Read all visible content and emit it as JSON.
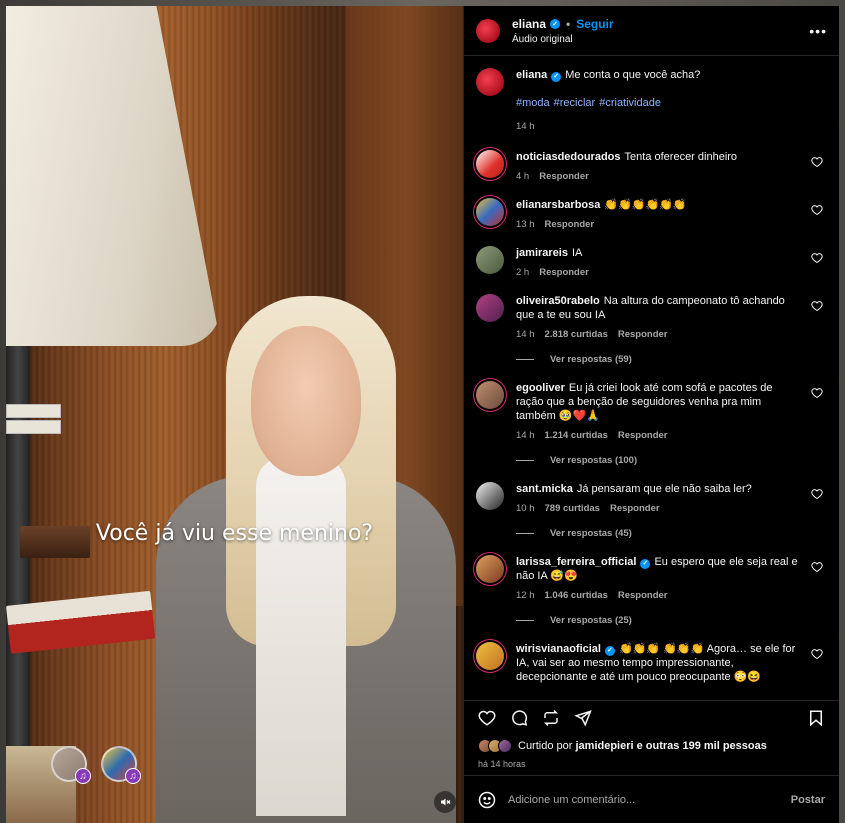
{
  "post": {
    "username": "eliana",
    "follow_label": "Seguir",
    "audio_label": "Áudio original",
    "more_icon": "more-horizontal-icon",
    "video_caption": "Você já viu esse menino?",
    "caption_text": "Me conta o que você acha?",
    "hashtags": [
      "#moda",
      "#reciclar",
      "#criatividade"
    ],
    "caption_time": "14 h"
  },
  "comments": [
    {
      "user": "noticiasdedourados",
      "verified": false,
      "text": "Tenta oferecer dinheiro",
      "time": "4 h",
      "likes": "",
      "reply_label": "Responder",
      "replies": ""
    },
    {
      "user": "elianarsbarbosa",
      "verified": false,
      "text": "👏👏👏👏👏👏",
      "time": "13 h",
      "likes": "",
      "reply_label": "Responder",
      "replies": ""
    },
    {
      "user": "jamirareis",
      "verified": false,
      "text": "IA",
      "time": "2 h",
      "likes": "",
      "reply_label": "Responder",
      "replies": ""
    },
    {
      "user": "oliveira50rabelo",
      "verified": false,
      "text": "Na altura do campeonato tô achando que a te eu sou IA",
      "time": "14 h",
      "likes": "2.818 curtidas",
      "reply_label": "Responder",
      "replies": "Ver respostas (59)"
    },
    {
      "user": "egooliver",
      "verified": false,
      "text": "Eu já criei look até com sofá e pacotes de ração que a benção de seguidores venha pra mim também 🥹❤️🙏",
      "time": "14 h",
      "likes": "1.214 curtidas",
      "reply_label": "Responder",
      "replies": "Ver respostas (100)"
    },
    {
      "user": "sant.micka",
      "verified": false,
      "text": "Já pensaram que ele não saiba ler?",
      "time": "10 h",
      "likes": "789 curtidas",
      "reply_label": "Responder",
      "replies": "Ver respostas (45)"
    },
    {
      "user": "larissa_ferreira_official",
      "verified": true,
      "text": "Eu espero que ele seja real e não IA 😅😍",
      "time": "12 h",
      "likes": "1.046 curtidas",
      "reply_label": "Responder",
      "replies": "Ver respostas (25)"
    },
    {
      "user": "wirisvianaoficial",
      "verified": true,
      "text": "👏👏👏 👏👏👏 Agora… se ele for IA, vai ser ao mesmo tempo impressionante, decepcionante e até um pouco preocupante 😳😆",
      "time": "",
      "likes": "",
      "reply_label": "",
      "replies": ""
    }
  ],
  "actions": {
    "like_icon": "heart-icon",
    "comment_icon": "comment-icon",
    "share_icon": "repost-icon",
    "send_icon": "send-icon",
    "save_icon": "bookmark-icon"
  },
  "likes": {
    "prefix": "Curtido por",
    "user": "jamidepieri",
    "suffix": "e outras 199 mil pessoas",
    "time": "há 14 horas"
  },
  "add_comment": {
    "placeholder": "Adicione um comentário...",
    "post_label": "Postar"
  },
  "colors": {
    "accent": "#0095f6",
    "hashtag": "#8cb4ff",
    "background": "#000000",
    "muted": "#a8a8a8"
  }
}
